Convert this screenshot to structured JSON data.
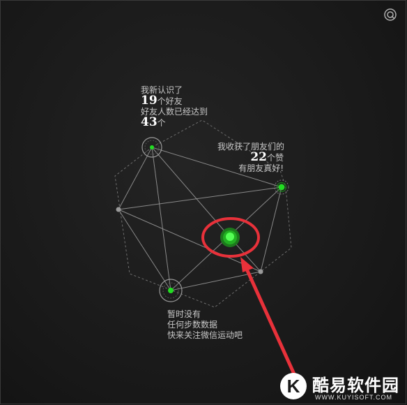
{
  "colors": {
    "background": "#1b1b1b",
    "node_green": "#22dd22",
    "highlight_red": "#e8313a",
    "line": "#8a8a8a"
  },
  "icons": {
    "settings": "target-icon",
    "watermark_logo": "k-logo-icon"
  },
  "friends": {
    "line1": "我新认识了",
    "count": "19",
    "count_unit": "个好友",
    "line3": "好友人数已经达到",
    "total": "43",
    "total_unit": "个"
  },
  "likes": {
    "line1": "我收获了朋友们的",
    "count": "22",
    "count_unit": "个赞",
    "line3": "有朋友真好!"
  },
  "steps": {
    "line1": "暂时没有",
    "line2": "任何步数数据",
    "line3": "快来关注微信运动吧"
  },
  "watermark": {
    "logo_letter": "K",
    "title": "酷易软件园",
    "url": "WWW.KUYISOFT.COM"
  }
}
